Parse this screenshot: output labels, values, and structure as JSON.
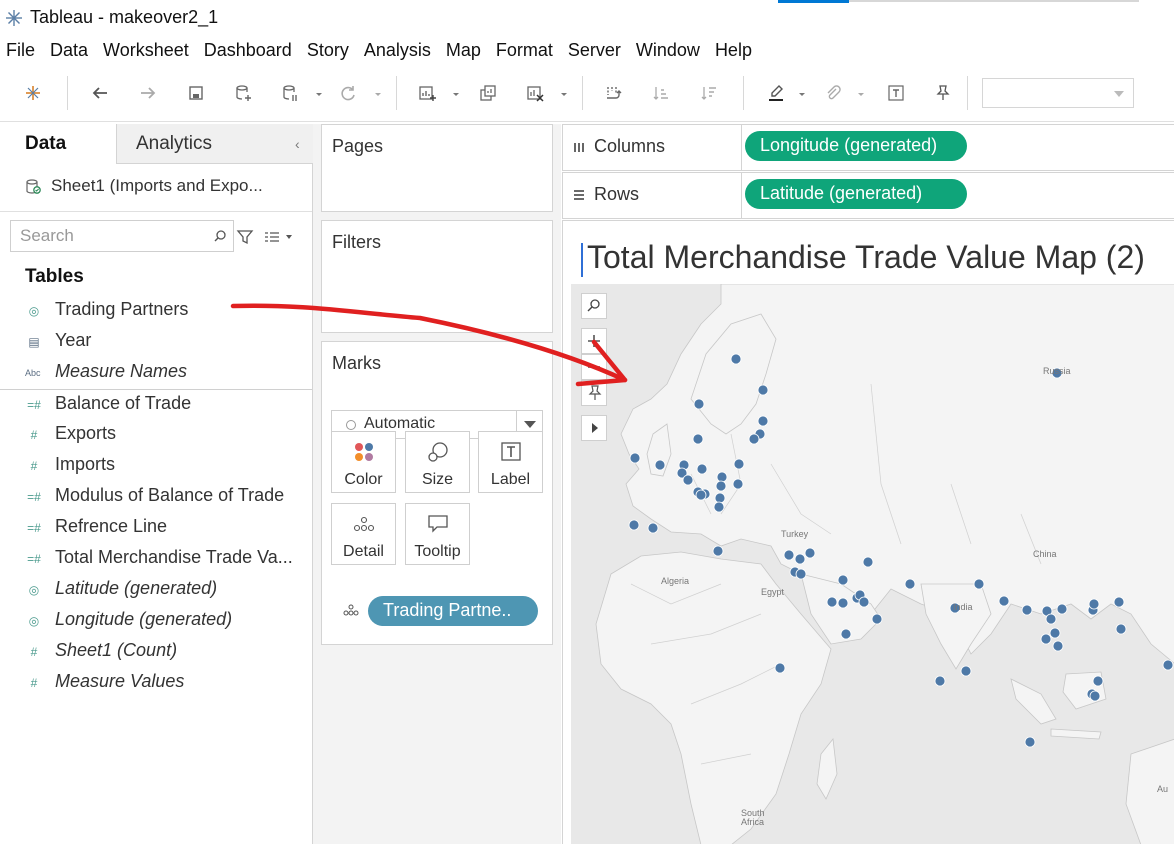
{
  "window": {
    "title": "Tableau - makeover2_1"
  },
  "menu": [
    "File",
    "Data",
    "Worksheet",
    "Dashboard",
    "Story",
    "Analysis",
    "Map",
    "Format",
    "Server",
    "Window",
    "Help"
  ],
  "data_pane": {
    "tab_data": "Data",
    "tab_analytics": "Analytics",
    "datasource": "Sheet1 (Imports and Expo...",
    "search_placeholder": "Search",
    "tables_heading": "Tables",
    "fields": [
      {
        "name": "Trading Partners",
        "icon": "globe-icon",
        "italic": false
      },
      {
        "name": "Year",
        "icon": "calendar-icon",
        "italic": false
      },
      {
        "name": "Measure Names",
        "icon": "abc-icon",
        "italic": true
      },
      {
        "name": "Balance of Trade",
        "icon": "calc-measure-icon",
        "italic": false
      },
      {
        "name": "Exports",
        "icon": "measure-icon",
        "italic": false
      },
      {
        "name": "Imports",
        "icon": "measure-icon",
        "italic": false
      },
      {
        "name": "Modulus of Balance of Trade",
        "icon": "calc-measure-icon",
        "italic": false
      },
      {
        "name": "Refrence Line",
        "icon": "calc-measure-icon",
        "italic": false
      },
      {
        "name": "Total Merchandise Trade Va...",
        "icon": "calc-measure-icon",
        "italic": false
      },
      {
        "name": "Latitude (generated)",
        "icon": "globe-icon",
        "italic": true
      },
      {
        "name": "Longitude (generated)",
        "icon": "globe-icon",
        "italic": true
      },
      {
        "name": "Sheet1 (Count)",
        "icon": "measure-icon",
        "italic": true
      },
      {
        "name": "Measure Values",
        "icon": "measure-icon",
        "italic": true
      }
    ]
  },
  "shelves": {
    "pages": "Pages",
    "filters": "Filters",
    "marks": "Marks",
    "mark_type": "Automatic",
    "mark_buttons": [
      "Color",
      "Size",
      "Label",
      "Detail",
      "Tooltip"
    ],
    "detail_pill": "Trading Partne..",
    "columns_label": "Columns",
    "rows_label": "Rows",
    "columns_pill": "Longitude (generated)",
    "rows_pill": "Latitude (generated)"
  },
  "view": {
    "title": "Total Merchandise Trade Value Map (2)",
    "map_labels": [
      "Russia",
      "Turkey",
      "Algeria",
      "Egypt",
      "China",
      "India",
      "South Africa",
      "Au"
    ]
  },
  "colors": {
    "accent": "#0078d4",
    "green_pill": "#0fa57a",
    "blue_pill": "#4e96b3",
    "mark_dot": "#4e79a7",
    "annotation": "#e02020"
  }
}
